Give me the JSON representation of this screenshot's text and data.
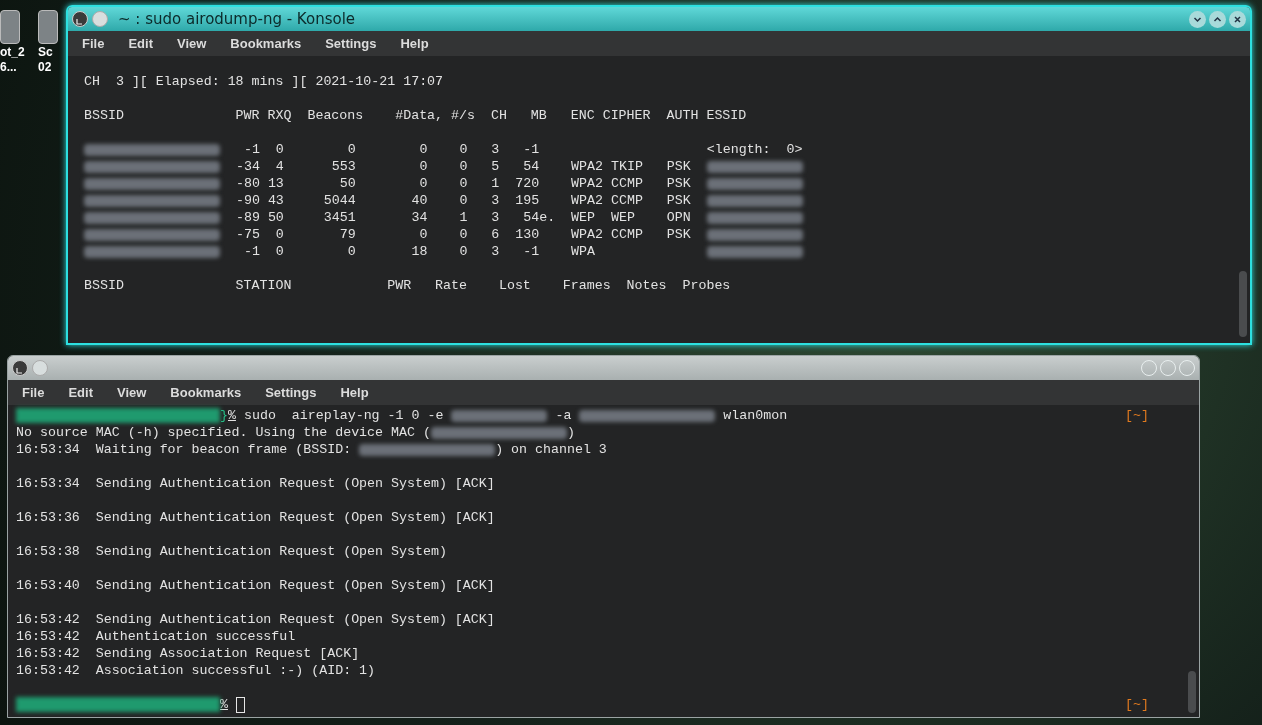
{
  "desktop_icons": [
    {
      "lines": [
        "ot_2",
        "6..."
      ]
    },
    {
      "lines": [
        "Sc",
        "02"
      ]
    }
  ],
  "windows": [
    {
      "title": "~ : sudo airodump-ng - Konsole",
      "active": true,
      "menu": [
        "File",
        "Edit",
        "View",
        "Bookmarks",
        "Settings",
        "Help"
      ],
      "lines": [
        {
          "kind": "blank"
        },
        {
          "kind": "text",
          "segments": [
            {
              "kind": "text",
              "text": "CH  3 ][ Elapsed: 18 mins ][ 2021-10-21 17:07"
            }
          ]
        },
        {
          "kind": "blank"
        },
        {
          "kind": "text",
          "segments": [
            {
              "kind": "text",
              "text": "BSSID              PWR RXQ  Beacons    #Data, #/s  CH   MB   ENC CIPHER  AUTH ESSID"
            }
          ]
        },
        {
          "kind": "blank"
        },
        {
          "kind": "text",
          "segments": [
            {
              "kind": "blur_mac"
            },
            {
              "kind": "text",
              "text": "   -1  0        0        0    0   3   -1                     <length:  0>"
            }
          ]
        },
        {
          "kind": "text",
          "segments": [
            {
              "kind": "blur_mac"
            },
            {
              "kind": "text",
              "text": "  -34  4      553        0    0   5   54    WPA2 TKIP   PSK  "
            },
            {
              "kind": "blur_name"
            }
          ]
        },
        {
          "kind": "text",
          "segments": [
            {
              "kind": "blur_mac"
            },
            {
              "kind": "text",
              "text": "  -80 13       50        0    0   1  720    WPA2 CCMP   PSK  "
            },
            {
              "kind": "blur_name"
            }
          ]
        },
        {
          "kind": "text",
          "segments": [
            {
              "kind": "blur_mac"
            },
            {
              "kind": "text",
              "text": "  -90 43     5044       40    0   3  195    WPA2 CCMP   PSK  "
            },
            {
              "kind": "blur_name"
            }
          ]
        },
        {
          "kind": "text",
          "segments": [
            {
              "kind": "blur_mac"
            },
            {
              "kind": "text",
              "text": "  -89 50     3451       34    1   3   54e.  WEP  WEP    OPN  "
            },
            {
              "kind": "blur_name"
            }
          ]
        },
        {
          "kind": "text",
          "segments": [
            {
              "kind": "blur_mac"
            },
            {
              "kind": "text",
              "text": "  -75  0       79        0    0   6  130    WPA2 CCMP   PSK  "
            },
            {
              "kind": "blur_name"
            }
          ]
        },
        {
          "kind": "text",
          "segments": [
            {
              "kind": "blur_mac"
            },
            {
              "kind": "text",
              "text": "   -1  0        0       18    0   3   -1    WPA              "
            },
            {
              "kind": "blur_name"
            }
          ]
        },
        {
          "kind": "blank"
        },
        {
          "kind": "text",
          "segments": [
            {
              "kind": "text",
              "text": "BSSID              STATION            PWR   Rate    Lost    Frames  Notes  Probes"
            }
          ]
        }
      ]
    },
    {
      "active": false,
      "menu": [
        "File",
        "Edit",
        "View",
        "Bookmarks",
        "Settings",
        "Help"
      ],
      "lines": [
        {
          "kind": "text",
          "tag": "[~]",
          "segments": [
            {
              "kind": "blur_prompt"
            },
            {
              "kind": "accent",
              "text": "}"
            },
            {
              "kind": "mark",
              "text": "%"
            },
            {
              "kind": "text",
              "text": " sudo  aireplay-ng -1 0 -e "
            },
            {
              "kind": "blur_name"
            },
            {
              "kind": "text",
              "text": " -a "
            },
            {
              "kind": "blur_mac"
            },
            {
              "kind": "text",
              "text": " wlan0mon"
            }
          ]
        },
        {
          "kind": "text",
          "segments": [
            {
              "kind": "text",
              "text": "No source MAC (-h) specified. Using the device MAC ("
            },
            {
              "kind": "blur_mac"
            },
            {
              "kind": "text",
              "text": ")"
            }
          ]
        },
        {
          "kind": "text",
          "segments": [
            {
              "kind": "text",
              "text": "16:53:34  Waiting for beacon frame (BSSID: "
            },
            {
              "kind": "blur_mac"
            },
            {
              "kind": "text",
              "text": ") on channel 3"
            }
          ]
        },
        {
          "kind": "blank"
        },
        {
          "kind": "text",
          "segments": [
            {
              "kind": "text",
              "text": "16:53:34  Sending Authentication Request (Open System) [ACK]"
            }
          ]
        },
        {
          "kind": "blank"
        },
        {
          "kind": "text",
          "segments": [
            {
              "kind": "text",
              "text": "16:53:36  Sending Authentication Request (Open System) [ACK]"
            }
          ]
        },
        {
          "kind": "blank"
        },
        {
          "kind": "text",
          "segments": [
            {
              "kind": "text",
              "text": "16:53:38  Sending Authentication Request (Open System)"
            }
          ]
        },
        {
          "kind": "blank"
        },
        {
          "kind": "text",
          "segments": [
            {
              "kind": "text",
              "text": "16:53:40  Sending Authentication Request (Open System) [ACK]"
            }
          ]
        },
        {
          "kind": "blank"
        },
        {
          "kind": "text",
          "segments": [
            {
              "kind": "text",
              "text": "16:53:42  Sending Authentication Request (Open System) [ACK]"
            }
          ]
        },
        {
          "kind": "text",
          "segments": [
            {
              "kind": "text",
              "text": "16:53:42  Authentication successful"
            }
          ]
        },
        {
          "kind": "text",
          "segments": [
            {
              "kind": "text",
              "text": "16:53:42  Sending Association Request [ACK]"
            }
          ]
        },
        {
          "kind": "text",
          "segments": [
            {
              "kind": "text",
              "text": "16:53:42  Association successful :-) (AID: 1)"
            }
          ]
        },
        {
          "kind": "blank"
        },
        {
          "kind": "text",
          "tag": "[~]",
          "segments": [
            {
              "kind": "blur_prompt"
            },
            {
              "kind": "mark",
              "text": "%"
            },
            {
              "kind": "cursor"
            }
          ]
        }
      ]
    }
  ]
}
